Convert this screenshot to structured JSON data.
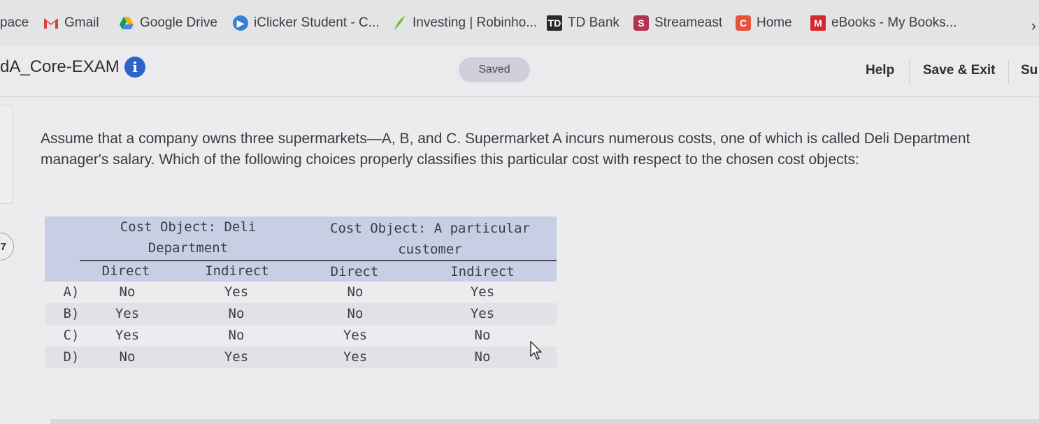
{
  "bookmarks": [
    {
      "label": "pace",
      "icon": ""
    },
    {
      "label": "Gmail",
      "icon": "gmail-icon"
    },
    {
      "label": "Google Drive",
      "icon": "google-drive-icon"
    },
    {
      "label": "iClicker Student - C...",
      "icon": "iclicker-icon"
    },
    {
      "label": "Investing | Robinho...",
      "icon": "robinhood-feather-icon"
    },
    {
      "label": "TD Bank",
      "icon": "td-bank-icon"
    },
    {
      "label": "Streameast",
      "icon": "streameast-icon"
    },
    {
      "label": "Home",
      "icon": "c-home-icon"
    },
    {
      "label": "eBooks - My Books...",
      "icon": "mheducation-icon"
    }
  ],
  "header": {
    "title": "dA_Core-EXAM",
    "info_icon_glyph": "i",
    "saved_label": "Saved",
    "help_label": "Help",
    "save_exit_label": "Save & Exit",
    "submit_label": "Su"
  },
  "question": {
    "number": "7",
    "text": "Assume that a company owns three supermarkets—A, B, and C. Supermarket A incurs numerous costs, one of which is called Deli Department manager's salary. Which of the following choices properly classifies this particular cost with respect to the chosen cost objects:"
  },
  "table": {
    "group1_line1": "Cost Object: Deli",
    "group1_line2": "Department",
    "group2_line1": "Cost Object: A particular",
    "group2_line2": "customer",
    "columns": [
      "Direct",
      "Indirect",
      "Direct",
      "Indirect"
    ],
    "rows": [
      {
        "label": "A)",
        "values": [
          "No",
          "Yes",
          "No",
          "Yes"
        ]
      },
      {
        "label": "B)",
        "values": [
          "Yes",
          "No",
          "No",
          "Yes"
        ]
      },
      {
        "label": "C)",
        "values": [
          "Yes",
          "No",
          "Yes",
          "No"
        ]
      },
      {
        "label": "D)",
        "values": [
          "No",
          "Yes",
          "Yes",
          "No"
        ]
      }
    ]
  },
  "colors": {
    "info_blue": "#2d63c8",
    "table_header": "#c8cfe4"
  }
}
